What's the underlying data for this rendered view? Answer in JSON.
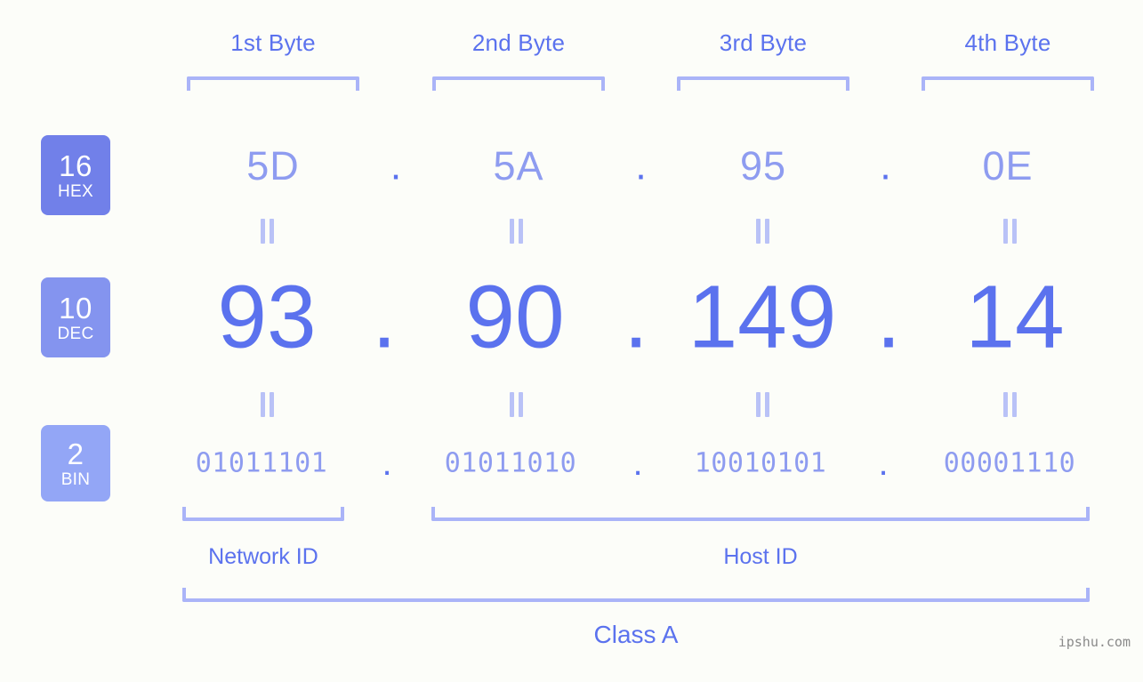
{
  "meta": {
    "watermark": "ipshu.com",
    "background_color": "#fcfdf9",
    "accent_color": "#5b72ee",
    "light_accent_color": "#8e9cf0",
    "bracket_color": "#aab4f8"
  },
  "byte_headers": [
    {
      "label": "1st Byte"
    },
    {
      "label": "2nd Byte"
    },
    {
      "label": "3rd Byte"
    },
    {
      "label": "4th Byte"
    }
  ],
  "bases": [
    {
      "number": "16",
      "name": "HEX",
      "color": "#7180e9"
    },
    {
      "number": "10",
      "name": "DEC",
      "color": "#8494ef"
    },
    {
      "number": "2",
      "name": "BIN",
      "color": "#93a6f6"
    }
  ],
  "rows": {
    "hex": {
      "values": [
        "5D",
        "5A",
        "95",
        "0E"
      ],
      "separator": "."
    },
    "dec": {
      "values": [
        "93",
        "90",
        "149",
        "14"
      ],
      "separator": "."
    },
    "bin": {
      "values": [
        "01011101",
        "01011010",
        "10010101",
        "00001110"
      ],
      "separator": "."
    }
  },
  "equals_separator": "=",
  "segments": [
    {
      "label": "Network ID"
    },
    {
      "label": "Host ID"
    }
  ],
  "class": {
    "label": "Class A"
  }
}
